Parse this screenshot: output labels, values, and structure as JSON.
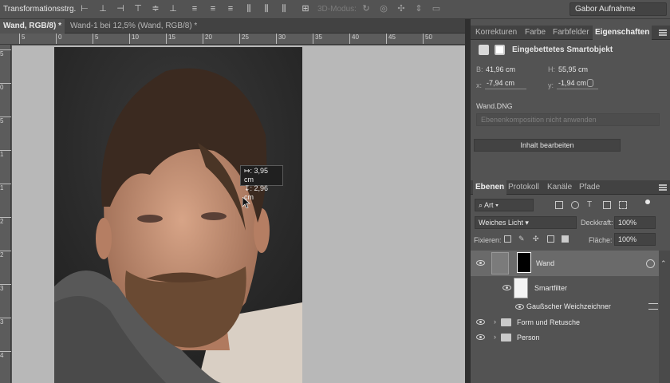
{
  "optionsbar": {
    "tool_label": "Transformationsstrg.",
    "mode3d_label": "3D-Modus:",
    "workspace": "Gabor Aufnahme"
  },
  "document_tabs": [
    {
      "label": "Wand, RGB/8) *",
      "active": true
    },
    {
      "label": "Wand-1 bei 12,5% (Wand, RGB/8) *",
      "active": false
    }
  ],
  "ruler": {
    "h_ticks": [
      "5",
      "0",
      "5",
      "10",
      "15",
      "20",
      "25",
      "30",
      "35",
      "40",
      "45",
      "50"
    ],
    "v_ticks": [
      "5",
      "0",
      "5",
      "1",
      "1",
      "2",
      "2",
      "3",
      "3",
      "4"
    ]
  },
  "measure_tooltip": {
    "width": "↦: 3,95 cm",
    "height": "↧: 2,96 cm"
  },
  "properties": {
    "tabs": [
      "Korrekturen",
      "Farbe",
      "Farbfelder",
      "Eigenschaften"
    ],
    "active_tab": "Eigenschaften",
    "object_type": "Eingebettetes Smartobjekt",
    "b_label": "B:",
    "b_value": "41,96 cm",
    "h_label": "H:",
    "h_value": "55,95 cm",
    "x_label": "x:",
    "x_value": "-7,94 cm",
    "y_label": "y:",
    "y_value": "-1,94 cm",
    "file": "Wand.DNG",
    "comp_placeholder": "Ebenenkomposition nicht anwenden",
    "edit_button": "Inhalt bearbeiten"
  },
  "layers_panel": {
    "tabs": [
      "Ebenen",
      "Protokoll",
      "Kanäle",
      "Pfade"
    ],
    "active_tab": "Ebenen",
    "filter_kind": "Art",
    "blend_mode": "Weiches Licht",
    "opacity_label": "Deckkraft:",
    "opacity": "100%",
    "lock_label": "Fixieren:",
    "fill_label": "Fläche:",
    "fill": "100%",
    "layers": [
      {
        "name": "Wand",
        "selected": true
      },
      {
        "name": "Smartfilter"
      },
      {
        "name": "Gaußscher Weichzeichner"
      },
      {
        "name": "Form und Retusche",
        "type": "group"
      },
      {
        "name": "Person",
        "type": "group"
      }
    ]
  },
  "colors": {
    "panel_bg": "#535353",
    "canvas_bg": "#b8b8b8",
    "selected_row": "#6a6a6a"
  }
}
